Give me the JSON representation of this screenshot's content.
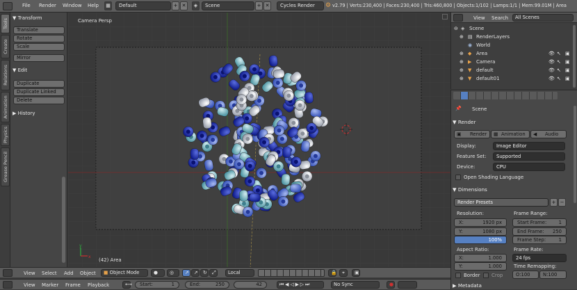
{
  "topbar": {
    "menus": [
      "File",
      "Render",
      "Window",
      "Help"
    ],
    "layout": "Default",
    "scene": "Scene",
    "engine": "Cycles Render",
    "stats": "v2.79 | Verts:230,400 | Faces:230,400 | Tris:460,800 | Objects:1/102 | Lamps:1/1 | Mem:99.01M | Area"
  },
  "tabs": [
    "Tools",
    "Create",
    "Relations",
    "Animation",
    "Physics",
    "Grease Pencil"
  ],
  "toolshelf": {
    "transform_header": "Transform",
    "transform_buttons": [
      "Translate",
      "Rotate",
      "Scale"
    ],
    "mirror": "Mirror",
    "edit_header": "Edit",
    "edit_buttons": [
      "Duplicate",
      "Duplicate Linked",
      "Delete"
    ],
    "history_header": "History"
  },
  "viewport": {
    "view_name": "Camera Persp",
    "object_label": "(42) Area"
  },
  "view3d_header": {
    "menus": [
      "View",
      "Select",
      "Add",
      "Object"
    ],
    "mode": "Object Mode",
    "pivot": "Local"
  },
  "timeline_header": {
    "menus": [
      "View",
      "Marker",
      "Frame",
      "Playback"
    ],
    "start": "Start:",
    "start_val": "1",
    "end": "End:",
    "end_val": "250",
    "current": "42",
    "sync": "No Sync"
  },
  "outliner": {
    "menus": [
      "View",
      "Search"
    ],
    "filter": "All Scenes",
    "items": [
      "Scene",
      "RenderLayers",
      "World",
      "Area",
      "Camera",
      "default",
      "default01"
    ]
  },
  "properties": {
    "context": "Scene",
    "render_header": "Render",
    "render_buttons": [
      "Render",
      "Animation",
      "Audio"
    ],
    "display_label": "Display:",
    "display_value": "Image Editor",
    "feature_label": "Feature Set:",
    "feature_value": "Supported",
    "device_label": "Device:",
    "device_value": "CPU",
    "osl_label": "Open Shading Language",
    "dimensions_header": "Dimensions",
    "render_presets": "Render Presets",
    "resolution_label": "Resolution:",
    "res_x": "X:",
    "res_x_val": "1920 px",
    "res_y": "Y:",
    "res_y_val": "1080 px",
    "res_pct": "100%",
    "frame_range_label": "Frame Range:",
    "start_frame": "Start Frame:",
    "start_frame_val": "1",
    "end_frame": "End Frame:",
    "end_frame_val": "250",
    "frame_step": "Frame Step:",
    "frame_step_val": "1",
    "aspect_label": "Aspect Ratio:",
    "asp_x": "X:",
    "asp_x_val": "1.000",
    "asp_y": "Y:",
    "asp_y_val": "1.000",
    "frame_rate_label": "Frame Rate:",
    "frame_rate_val": "24 fps",
    "time_remap_label": "Time Remapping:",
    "remap_old": "O:100",
    "remap_new": "N:100",
    "border": "Border",
    "crop": "Crop",
    "metadata_header": "Metadata"
  },
  "colors": {
    "bead_dark_blue": "#1f2fb8",
    "bead_mid_blue": "#4b6fd8",
    "bead_teal": "#79b7c2",
    "bead_white": "#e6e8ee",
    "passepartout": "#2d2d2d",
    "camera_frame": "#404040"
  }
}
